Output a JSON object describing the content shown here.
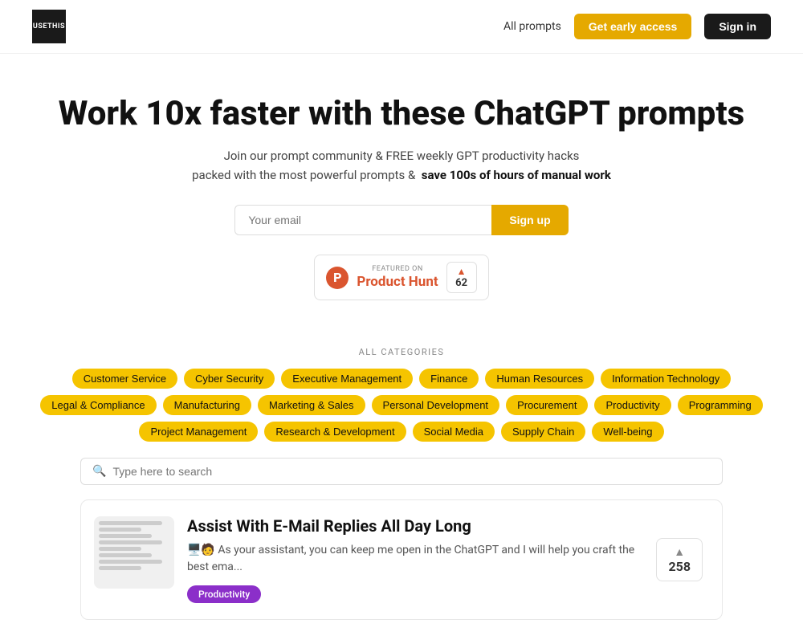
{
  "nav": {
    "logo_line1": "USE",
    "logo_line2": "THIS",
    "all_prompts_label": "All prompts",
    "early_access_label": "Get early access",
    "sign_in_label": "Sign in"
  },
  "hero": {
    "title": "Work 10x faster with these ChatGPT prompts",
    "sub1": "Join our prompt community & FREE weekly GPT productivity hacks",
    "sub2_plain": "packed with the most powerful prompts &",
    "sub2_bold": "save 100s of hours of manual work"
  },
  "email_form": {
    "placeholder": "Your email",
    "signup_label": "Sign up"
  },
  "product_hunt": {
    "featured_on": "FEATURED ON",
    "name": "Product Hunt",
    "upvote_count": "62"
  },
  "categories": {
    "label": "ALL CATEGORIES",
    "tags": [
      "Customer Service",
      "Cyber Security",
      "Executive Management",
      "Finance",
      "Human Resources",
      "Information Technology",
      "Legal & Compliance",
      "Manufacturing",
      "Marketing & Sales",
      "Personal Development",
      "Procurement",
      "Productivity",
      "Programming",
      "Project Management",
      "Research & Development",
      "Social Media",
      "Supply Chain",
      "Well-being"
    ]
  },
  "search": {
    "placeholder": "Type here to search"
  },
  "prompt_card": {
    "title": "Assist With E-Mail Replies All Day Long",
    "description": "🖥️🧑 As your assistant, you can keep me open in the ChatGPT and I will help you craft the best ema...",
    "tag": "Productivity",
    "votes": "258"
  },
  "icons": {
    "search": "🔍",
    "ph_letter": "P",
    "vote_arrow": "▲"
  }
}
